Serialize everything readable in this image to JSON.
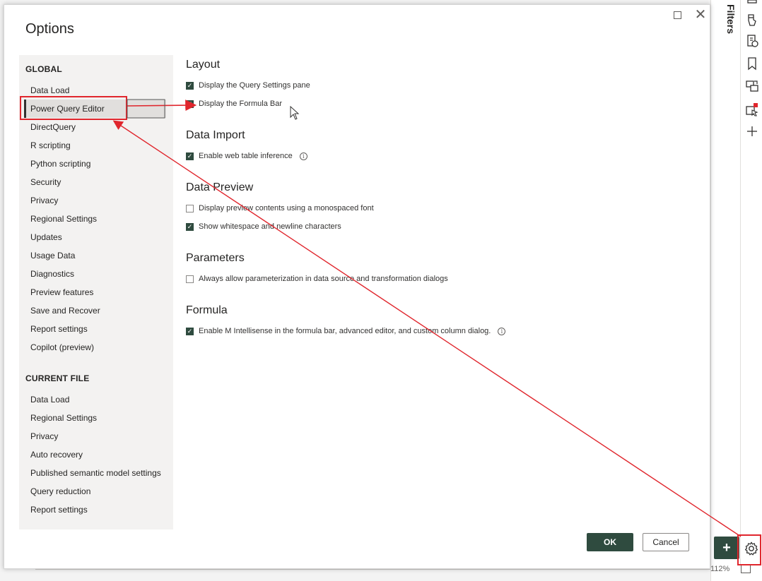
{
  "dialog": {
    "title": "Options",
    "maximize_icon": "maximize-icon",
    "close_glyph": "✕"
  },
  "nav": {
    "global_header": "GLOBAL",
    "global_items": [
      "Data Load",
      "Power Query Editor",
      "DirectQuery",
      "R scripting",
      "Python scripting",
      "Security",
      "Privacy",
      "Regional Settings",
      "Updates",
      "Usage Data",
      "Diagnostics",
      "Preview features",
      "Save and Recover",
      "Report settings",
      "Copilot (preview)"
    ],
    "selected": "Power Query Editor",
    "current_header": "CURRENT FILE",
    "current_items": [
      "Data Load",
      "Regional Settings",
      "Privacy",
      "Auto recovery",
      "Published semantic model settings",
      "Query reduction",
      "Report settings"
    ]
  },
  "content": {
    "sections": [
      {
        "title": "Layout",
        "options": [
          {
            "label": "Display the Query Settings pane",
            "checked": true,
            "info": false
          },
          {
            "label": "Display the Formula Bar",
            "checked": true,
            "info": false
          }
        ]
      },
      {
        "title": "Data Import",
        "options": [
          {
            "label": "Enable web table inference",
            "checked": true,
            "info": true
          }
        ]
      },
      {
        "title": "Data Preview",
        "options": [
          {
            "label": "Display preview contents using a monospaced font",
            "checked": false,
            "info": false
          },
          {
            "label": "Show whitespace and newline characters",
            "checked": true,
            "info": false
          }
        ]
      },
      {
        "title": "Parameters",
        "options": [
          {
            "label": "Always allow parameterization in data source and transformation dialogs",
            "checked": false,
            "info": false
          }
        ]
      },
      {
        "title": "Formula",
        "options": [
          {
            "label": "Enable M Intellisense in the formula bar, advanced editor, and custom column dialog.",
            "checked": true,
            "info": true
          }
        ]
      }
    ]
  },
  "buttons": {
    "ok": "OK",
    "cancel": "Cancel"
  },
  "app": {
    "filters_label": "Filters",
    "zoom": "112%",
    "plus_glyph": "+",
    "rail_icons": [
      "build-visual-icon",
      "format-icon",
      "analytics-icon",
      "bookmark-icon",
      "sync-icon",
      "selection-icon",
      "add-icon"
    ],
    "accent_color": "#2f4b3f",
    "annotation_color": "#e0262d"
  }
}
